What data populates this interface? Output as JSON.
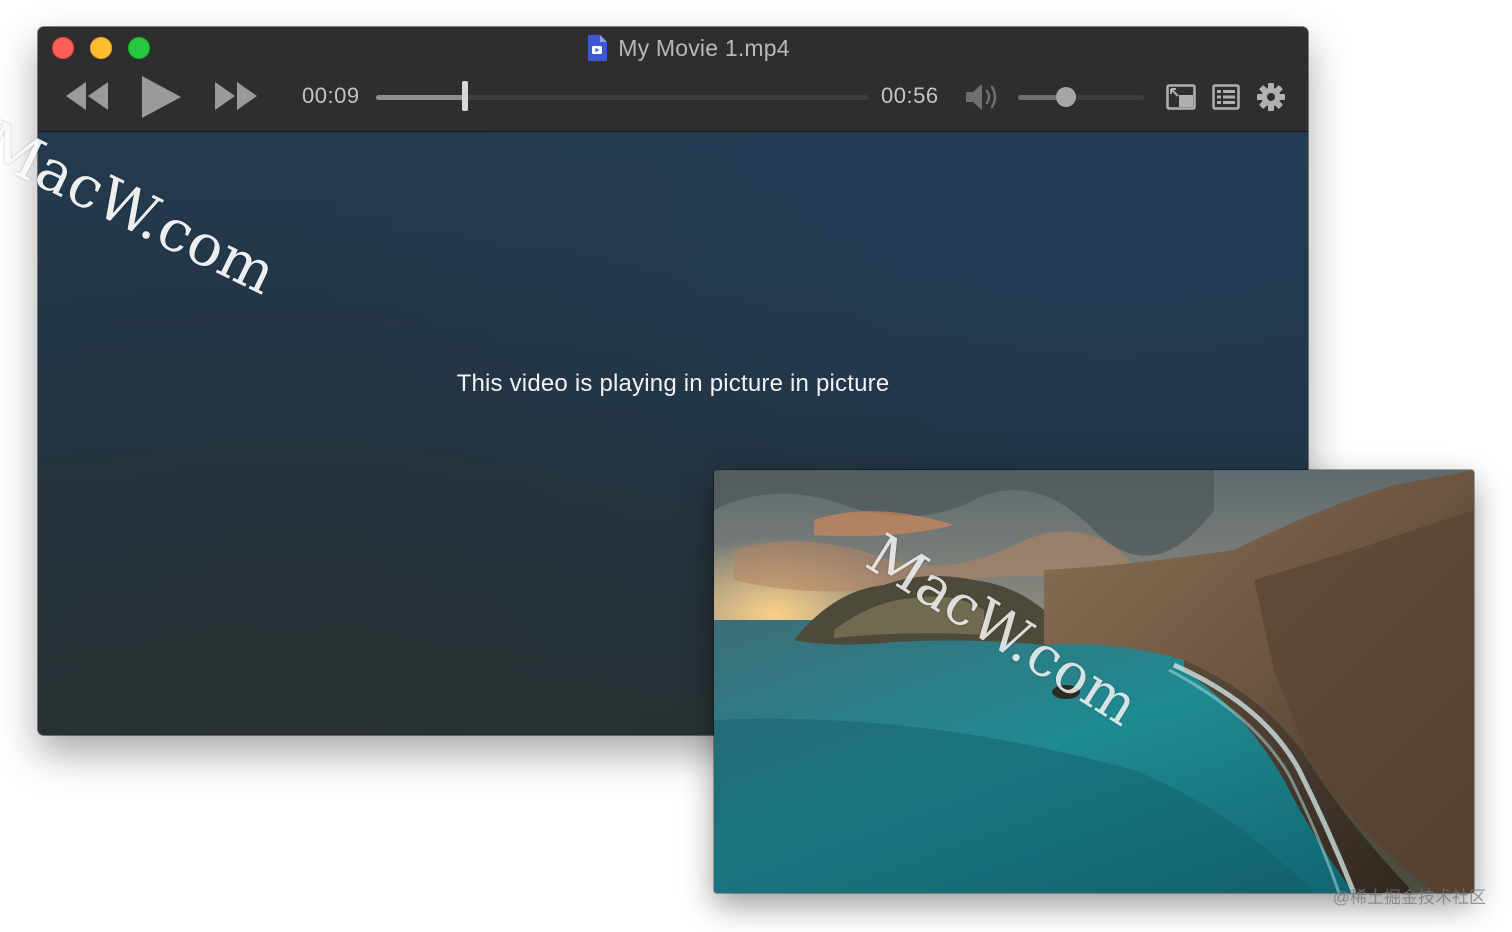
{
  "window": {
    "title": "My Movie 1.mp4",
    "traffic_lights": {
      "close_color": "#fe5f57",
      "minimize_color": "#febc2e",
      "zoom_color": "#28c840"
    }
  },
  "toolbar": {
    "rewind_icon": "rewind-icon",
    "play_icon": "play-icon",
    "fast_forward_icon": "fast-forward-icon",
    "current_time": "00:09",
    "duration": "00:56",
    "seek_progress": 0.18,
    "volume_icon": "speaker-volume-icon",
    "volume_level": 0.38,
    "pip_icon": "picture-in-picture-icon",
    "playlist_icon": "playlist-icon",
    "settings_icon": "gear-icon"
  },
  "content": {
    "pip_message": "This video is playing in picture in picture"
  },
  "pip_window": {
    "scene": "coastal-cliffs-sunset"
  },
  "watermarks": {
    "primary": "MacW.com",
    "secondary": "MacW.com"
  },
  "credit": "@稀土掘金技术社区"
}
